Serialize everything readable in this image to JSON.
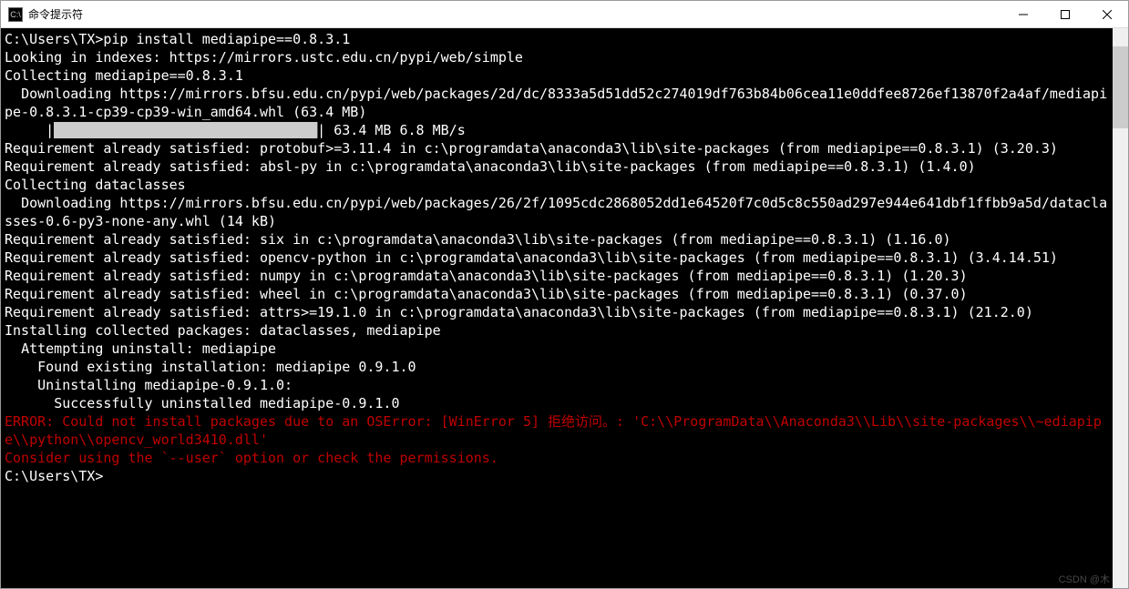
{
  "window": {
    "title": "命令提示符",
    "icon_label": "C:\\"
  },
  "terminal": {
    "lines": [
      {
        "t": "C:\\Users\\TX>pip install mediapipe==0.8.3.1",
        "c": "n"
      },
      {
        "t": "Looking in indexes: https://mirrors.ustc.edu.cn/pypi/web/simple",
        "c": "n"
      },
      {
        "t": "Collecting mediapipe==0.8.3.1",
        "c": "n"
      },
      {
        "t": "  Downloading https://mirrors.bfsu.edu.cn/pypi/web/packages/2d/dc/8333a5d51dd52c274019df763b84b06cea11e0ddfee8726ef13870f2a4af/mediapipe-0.8.3.1-cp39-cp39-win_amd64.whl (63.4 MB)",
        "c": "n"
      },
      {
        "t": "     |████████████████████████████████| 63.4 MB 6.8 MB/s",
        "c": "p"
      },
      {
        "t": "Requirement already satisfied: protobuf>=3.11.4 in c:\\programdata\\anaconda3\\lib\\site-packages (from mediapipe==0.8.3.1) (3.20.3)",
        "c": "n"
      },
      {
        "t": "Requirement already satisfied: absl-py in c:\\programdata\\anaconda3\\lib\\site-packages (from mediapipe==0.8.3.1) (1.4.0)",
        "c": "n"
      },
      {
        "t": "Collecting dataclasses",
        "c": "n"
      },
      {
        "t": "  Downloading https://mirrors.bfsu.edu.cn/pypi/web/packages/26/2f/1095cdc2868052dd1e64520f7c0d5c8c550ad297e944e641dbf1ffbb9a5d/dataclasses-0.6-py3-none-any.whl (14 kB)",
        "c": "n"
      },
      {
        "t": "Requirement already satisfied: six in c:\\programdata\\anaconda3\\lib\\site-packages (from mediapipe==0.8.3.1) (1.16.0)",
        "c": "n"
      },
      {
        "t": "Requirement already satisfied: opencv-python in c:\\programdata\\anaconda3\\lib\\site-packages (from mediapipe==0.8.3.1) (3.4.14.51)",
        "c": "n"
      },
      {
        "t": "Requirement already satisfied: numpy in c:\\programdata\\anaconda3\\lib\\site-packages (from mediapipe==0.8.3.1) (1.20.3)",
        "c": "n"
      },
      {
        "t": "Requirement already satisfied: wheel in c:\\programdata\\anaconda3\\lib\\site-packages (from mediapipe==0.8.3.1) (0.37.0)",
        "c": "n"
      },
      {
        "t": "Requirement already satisfied: attrs>=19.1.0 in c:\\programdata\\anaconda3\\lib\\site-packages (from mediapipe==0.8.3.1) (21.2.0)",
        "c": "n"
      },
      {
        "t": "Installing collected packages: dataclasses, mediapipe",
        "c": "n"
      },
      {
        "t": "  Attempting uninstall: mediapipe",
        "c": "n"
      },
      {
        "t": "    Found existing installation: mediapipe 0.9.1.0",
        "c": "n"
      },
      {
        "t": "    Uninstalling mediapipe-0.9.1.0:",
        "c": "n"
      },
      {
        "t": "      Successfully uninstalled mediapipe-0.9.1.0",
        "c": "n"
      },
      {
        "t": "ERROR: Could not install packages due to an OSError: [WinError 5] 拒绝访问。: 'C:\\\\ProgramData\\\\Anaconda3\\\\Lib\\\\site-packages\\\\~ediapipe\\\\python\\\\opencv_world3410.dll'",
        "c": "e"
      },
      {
        "t": "Consider using the `--user` option or check the permissions.",
        "c": "e"
      },
      {
        "t": "",
        "c": "n"
      },
      {
        "t": "C:\\Users\\TX>",
        "c": "prompt"
      }
    ]
  },
  "watermark": "CSDN @木"
}
